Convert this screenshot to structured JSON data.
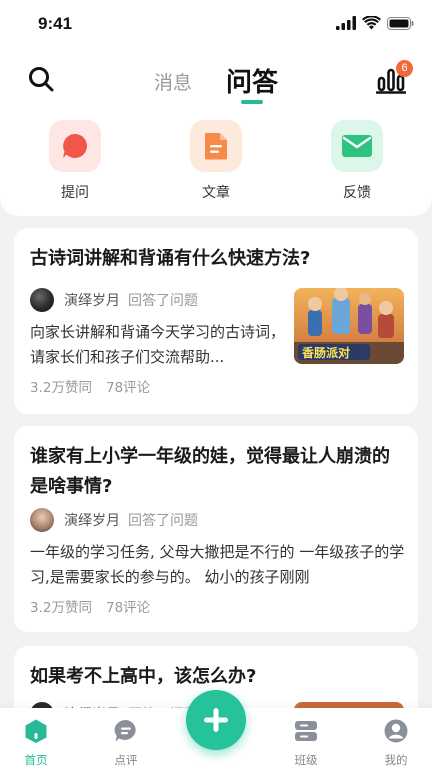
{
  "status_bar": {
    "time": "9:41"
  },
  "header": {
    "tabs": [
      {
        "label": "消息",
        "active": false
      },
      {
        "label": "问答",
        "active": true
      }
    ],
    "badge_count": "6",
    "icons": [
      "search-icon",
      "ranking-icon"
    ]
  },
  "actions": [
    {
      "label": "提问",
      "icon": "chat-bubble-icon",
      "color": "#f0564a",
      "bg": "#fde6e4"
    },
    {
      "label": "文章",
      "icon": "document-icon",
      "color": "#f58a4b",
      "bg": "#fdeadd"
    },
    {
      "label": "反馈",
      "icon": "mail-icon",
      "color": "#2ec37e",
      "bg": "#dcf6ea"
    }
  ],
  "posts": [
    {
      "title": "古诗词讲解和背诵有什么快速方法?",
      "author": "演绎岁月",
      "action": "回答了问题",
      "excerpt": "向家长讲解和背诵今天学习的古诗词，请家长们和孩子们交流帮助...",
      "likes": "3.2万赞同",
      "comments": "78评论",
      "thumb_text": "香肠派对"
    },
    {
      "title": "谁家有上小学一年级的娃，觉得最让人崩溃的是啥事情?",
      "author": "演绎岁月",
      "action": "回答了问题",
      "excerpt": "一年级的学习任务, 父母大撒把是不行的 一年级孩子的学习,是需要家长的参与的。 幼小的孩子刚刚",
      "likes": "3.2万赞同",
      "comments": "78评论"
    },
    {
      "title": "如果考不上高中，该怎么办?",
      "author": "演绎岁月",
      "action": "回答了问题"
    }
  ],
  "bottom_nav": [
    {
      "label": "首页",
      "icon": "home-icon",
      "active": true
    },
    {
      "label": "点评",
      "icon": "comment-icon",
      "active": false
    },
    {
      "label": "班级",
      "icon": "class-icon",
      "active": false
    },
    {
      "label": "我的",
      "icon": "profile-icon",
      "active": false
    }
  ],
  "colors": {
    "accent": "#27b99a",
    "fab": "#26c299",
    "badge": "#f06a40"
  }
}
